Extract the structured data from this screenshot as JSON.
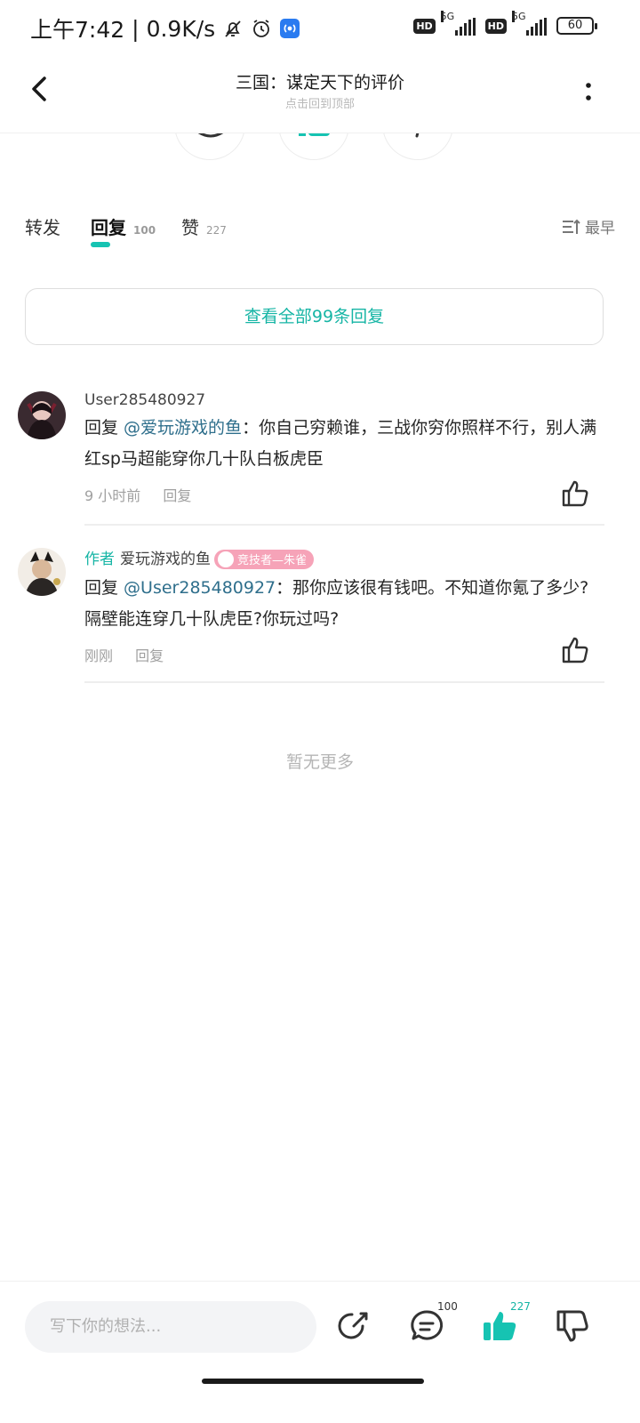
{
  "status_bar": {
    "time": "上午7:42",
    "speed": "0.9K/s",
    "signal1_label": "5G",
    "signal2_label": "5G",
    "hd": "HD",
    "battery": "60"
  },
  "header": {
    "title": "三国：谋定天下的评价",
    "subtitle": "点击回到顶部"
  },
  "tabs": {
    "forward": "转发",
    "reply": "回复",
    "reply_count": "100",
    "like": "赞",
    "like_count": "227",
    "sort": "最早"
  },
  "view_all": "查看全部99条回复",
  "comments": [
    {
      "user": "User285480927",
      "reply_prefix": "回复 ",
      "mention": "@爱玩游戏的鱼",
      "text": "：你自己穷赖谁，三战你穷你照样不行，别人满红sp马超能穿你几十队白板虎臣",
      "time": "9 小时前",
      "reply_label": "回复"
    },
    {
      "author_tag": "作者",
      "user": "爱玩游戏的鱼",
      "badge": "竞技者—朱雀",
      "reply_prefix": "回复 ",
      "mention": "@User285480927",
      "text": "：那你应该很有钱吧。不知道你氪了多少?隔壁能连穿几十队虎臣?你玩过吗?",
      "time": "刚刚",
      "reply_label": "回复"
    }
  ],
  "no_more": "暂无更多",
  "bottom_bar": {
    "input_placeholder": "写下你的想法...",
    "comment_count": "100",
    "like_count": "227"
  },
  "colors": {
    "accent": "#16c3b2",
    "mention": "#2f6f8c",
    "badge": "#f6a3b8"
  }
}
